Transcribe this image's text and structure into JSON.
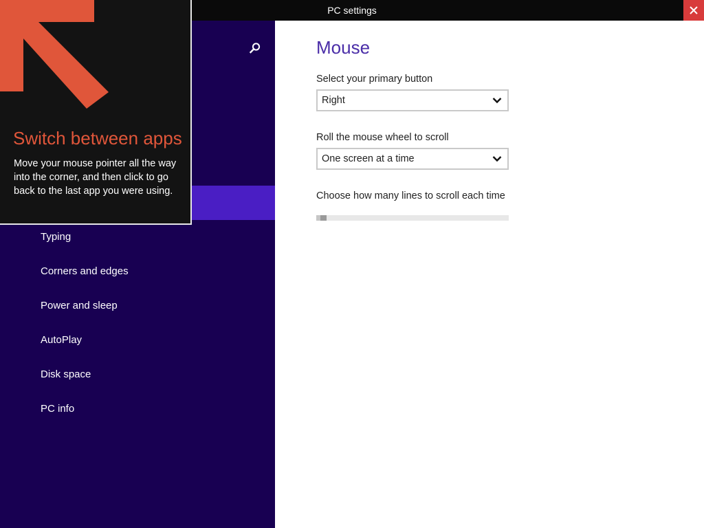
{
  "window": {
    "title": "PC settings",
    "close_icon": "close-icon"
  },
  "sidebar": {
    "search_icon": "search-icon",
    "items": [
      {
        "label": "Typing"
      },
      {
        "label": "Corners and edges"
      },
      {
        "label": "Power and sleep"
      },
      {
        "label": "AutoPlay"
      },
      {
        "label": "Disk space"
      },
      {
        "label": "PC info"
      }
    ]
  },
  "tip": {
    "title": "Switch between apps",
    "body": "Move your mouse pointer all the way into the corner, and then click to go back to the last app you were using.",
    "arrow_icon": "arrow-up-left-icon"
  },
  "main": {
    "title": "Mouse",
    "primary_button": {
      "label": "Select your primary button",
      "value": "Right"
    },
    "wheel_scroll": {
      "label": "Roll the mouse wheel to scroll",
      "value": "One screen at a time"
    },
    "lines_to_scroll": {
      "label": "Choose how many lines to scroll each time",
      "level": 0.03
    }
  },
  "colors": {
    "sidebar_bg": "#180052",
    "selected_bg": "#4a1ec4",
    "accent_title": "#4b2ea8",
    "tip_title": "#e0563a",
    "arrow": "#e0563a",
    "close_button": "#d83b3b"
  }
}
